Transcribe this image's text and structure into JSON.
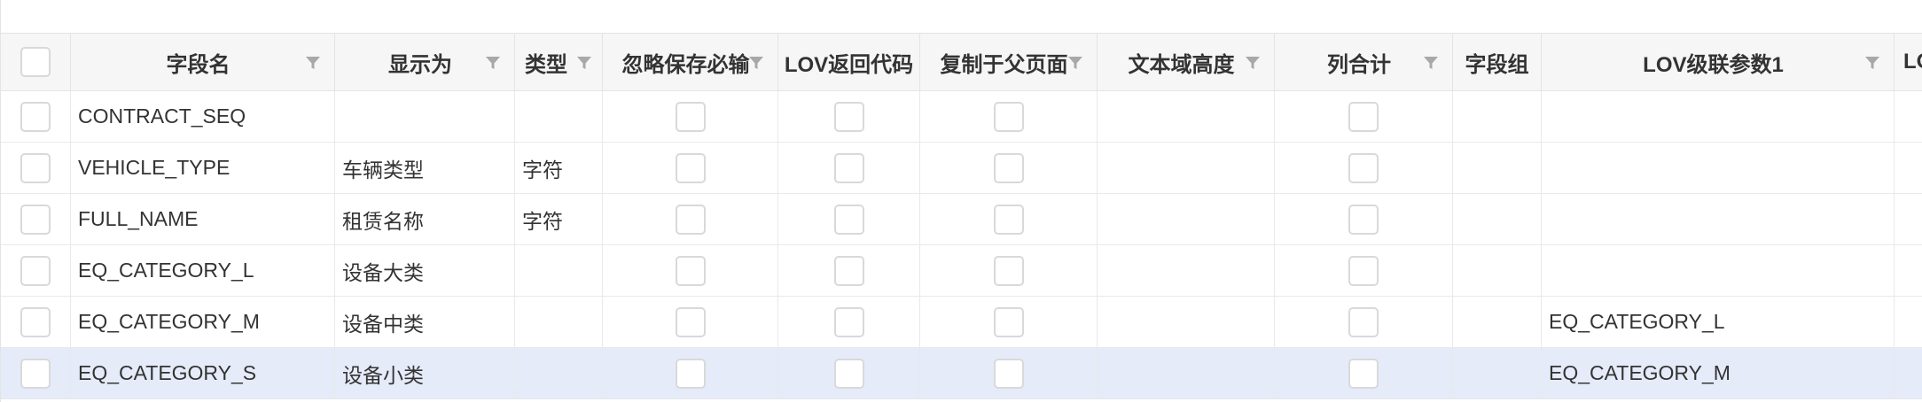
{
  "grid": {
    "columns": [
      {
        "key": "select",
        "label": "",
        "filter": false
      },
      {
        "key": "field_name",
        "label": "字段名",
        "filter": true
      },
      {
        "key": "display_as",
        "label": "显示为",
        "filter": true
      },
      {
        "key": "type",
        "label": "类型",
        "filter": true
      },
      {
        "key": "ignore_save_required",
        "label": "忽略保存必输",
        "filter": true
      },
      {
        "key": "lov_return_code",
        "label": "LOV返回代码",
        "filter": false
      },
      {
        "key": "copy_to_parent",
        "label": "复制于父页面",
        "filter": true
      },
      {
        "key": "textarea_height",
        "label": "文本域高度",
        "filter": true
      },
      {
        "key": "column_total",
        "label": "列合计",
        "filter": true
      },
      {
        "key": "field_group",
        "label": "字段组",
        "filter": false
      },
      {
        "key": "lov_cascade_param1",
        "label": "LOV级联参数1",
        "filter": true
      },
      {
        "key": "lov_more",
        "label": "LO",
        "filter": false
      }
    ],
    "rows": [
      {
        "field_name": "CONTRACT_SEQ",
        "display_as": "",
        "type": "",
        "lov_cascade_param1": "",
        "selected": false
      },
      {
        "field_name": "VEHICLE_TYPE",
        "display_as": "车辆类型",
        "type": "字符",
        "lov_cascade_param1": "",
        "selected": false
      },
      {
        "field_name": "FULL_NAME",
        "display_as": "租赁名称",
        "type": "字符",
        "lov_cascade_param1": "",
        "selected": false
      },
      {
        "field_name": "EQ_CATEGORY_L",
        "display_as": "设备大类",
        "type": "",
        "lov_cascade_param1": "",
        "selected": false
      },
      {
        "field_name": "EQ_CATEGORY_M",
        "display_as": "设备中类",
        "type": "",
        "lov_cascade_param1": "EQ_CATEGORY_L",
        "selected": false
      },
      {
        "field_name": "EQ_CATEGORY_S",
        "display_as": "设备小类",
        "type": "",
        "lov_cascade_param1": "EQ_CATEGORY_M",
        "selected": true
      }
    ]
  },
  "colors": {
    "header_bg": "#f6f6f6",
    "selected_row_bg": "#e6ebfa",
    "border": "#e4e4e4",
    "filter_icon": "#a8a8a8"
  }
}
